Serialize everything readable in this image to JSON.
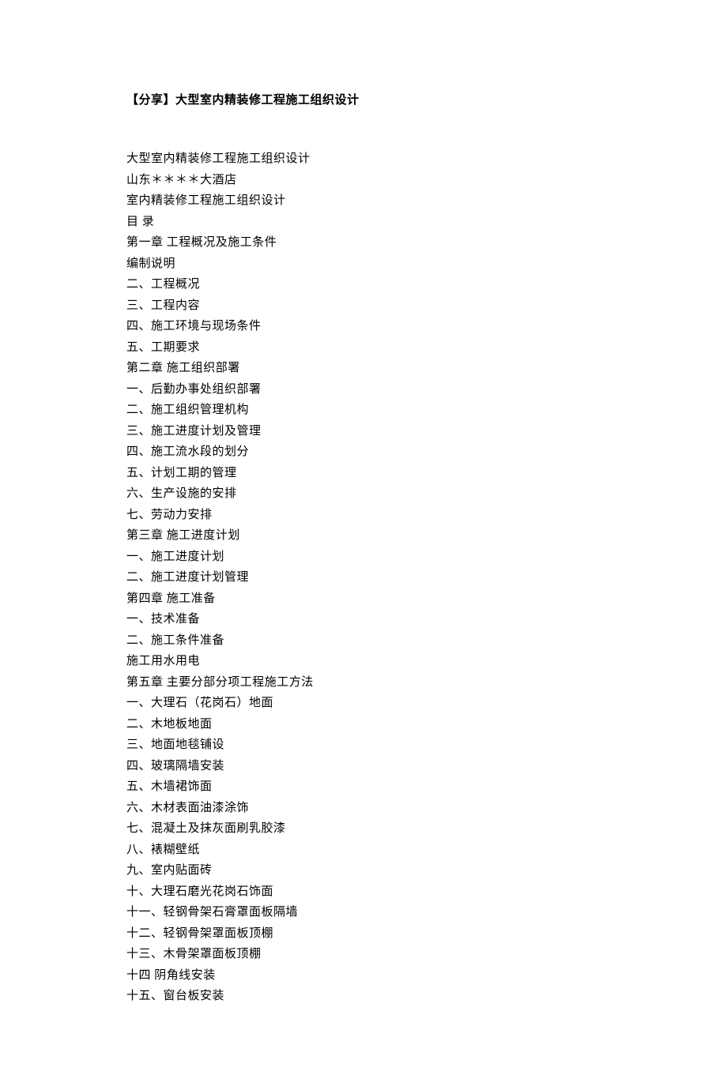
{
  "title": "【分享】大型室内精装修工程施工组织设计",
  "lines": [
    "大型室内精装修工程施工组织设计",
    "山东＊＊＊＊大酒店",
    "室内精装修工程施工组织设计",
    "目 录",
    "第一章 工程概况及施工条件",
    "编制说明",
    "二、工程概况",
    "三、工程内容",
    "四、施工环境与现场条件",
    "五、工期要求",
    "第二章 施工组织部署",
    "一、后勤办事处组织部署",
    "二、施工组织管理机构",
    "三、施工进度计划及管理",
    "四、施工流水段的划分",
    "五、计划工期的管理",
    "六、生产设施的安排",
    "七、劳动力安排",
    "第三章 施工进度计划",
    "一、施工进度计划",
    "二、施工进度计划管理",
    "第四章 施工准备",
    "一、技术准备",
    "二、施工条件准备",
    "施工用水用电",
    "第五章 主要分部分项工程施工方法",
    "一、大理石（花岗石）地面",
    "二、木地板地面",
    "三、地面地毯铺设",
    "四、玻璃隔墙安装",
    "五、木墙裙饰面",
    "六、木材表面油漆涂饰",
    "七、混凝土及抹灰面刷乳胶漆",
    "八、裱糊壁纸",
    "九、室内贴面砖",
    "十、大理石磨光花岗石饰面",
    "十一、轻钢骨架石膏罩面板隔墙",
    "十二、轻钢骨架罩面板顶棚",
    "十三、木骨架罩面板顶棚",
    "十四 阴角线安装",
    "十五、窗台板安装"
  ]
}
